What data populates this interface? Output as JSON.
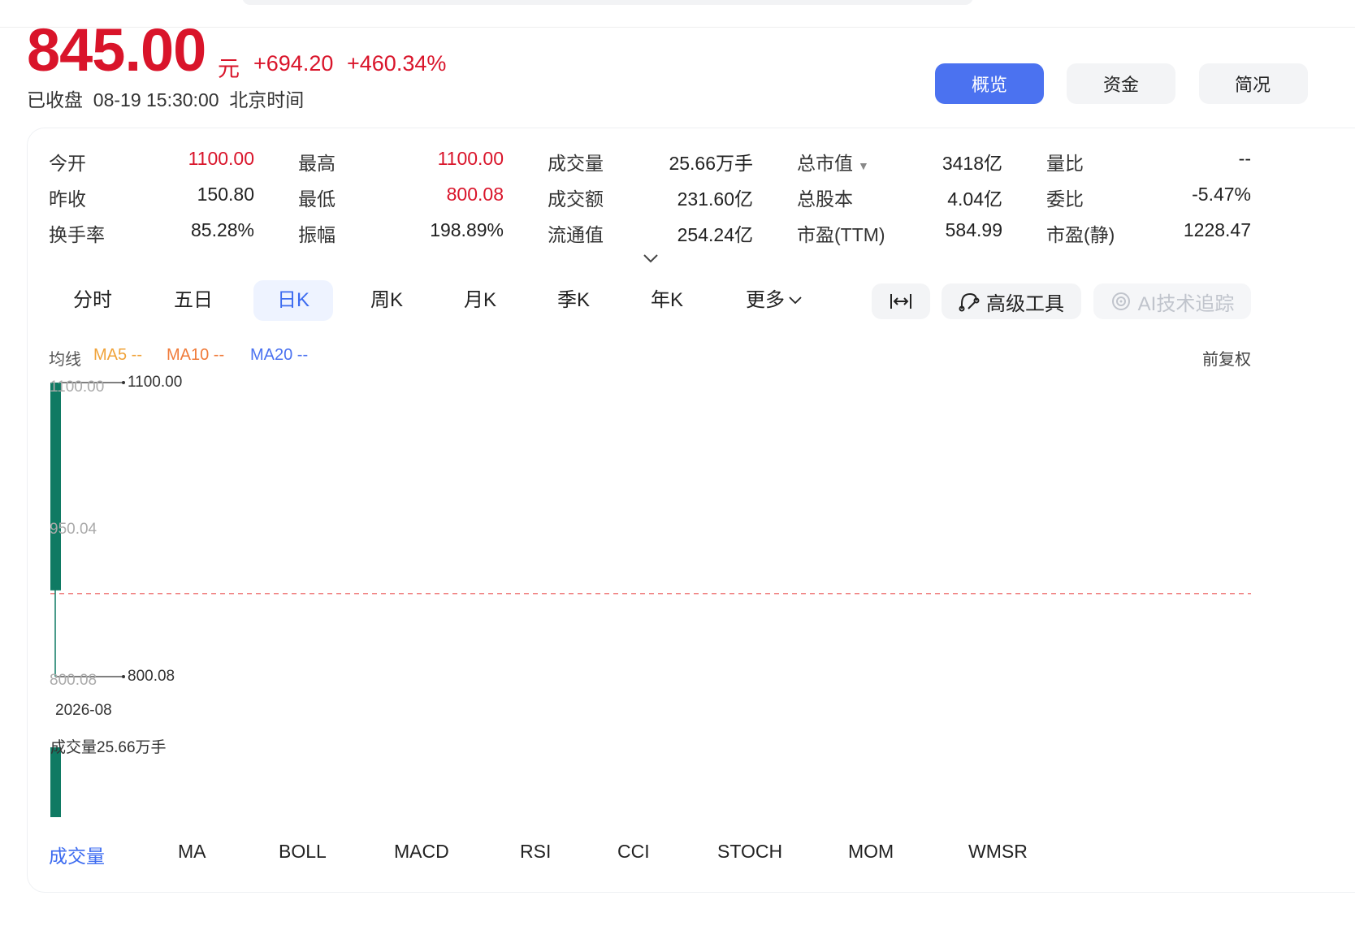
{
  "header": {
    "price": "845.00",
    "unit": "元",
    "change": "+694.20",
    "change_pct": "+460.34%",
    "status": "已收盘  08-19 15:30:00  北京时间"
  },
  "view_tabs": [
    {
      "label": "概览",
      "active": true
    },
    {
      "label": "资金",
      "active": false
    },
    {
      "label": "简况",
      "active": false
    }
  ],
  "quote": {
    "open": {
      "label": "今开",
      "value": "1100.00"
    },
    "high": {
      "label": "最高",
      "value": "1100.00"
    },
    "volume": {
      "label": "成交量",
      "value": "25.66万手"
    },
    "market_cap": {
      "label": "总市值",
      "value": "3418亿"
    },
    "volume_ratio": {
      "label": "量比",
      "value": "--"
    },
    "prev_close": {
      "label": "昨收",
      "value": "150.80"
    },
    "low": {
      "label": "最低",
      "value": "800.08"
    },
    "turnover_amount": {
      "label": "成交额",
      "value": "231.60亿"
    },
    "total_shares": {
      "label": "总股本",
      "value": "4.04亿"
    },
    "order_ratio": {
      "label": "委比",
      "value": "-5.47%"
    },
    "turnover_rate": {
      "label": "换手率",
      "value": "85.28%"
    },
    "amplitude": {
      "label": "振幅",
      "value": "198.89%"
    },
    "float_value": {
      "label": "流通值",
      "value": "254.24亿"
    },
    "pe_ttm": {
      "label": "市盈(TTM)",
      "value": "584.99"
    },
    "pe_static": {
      "label": "市盈(静)",
      "value": "1228.47"
    }
  },
  "periods": [
    {
      "label": "分时",
      "active": false
    },
    {
      "label": "五日",
      "active": false
    },
    {
      "label": "日K",
      "active": true
    },
    {
      "label": "周K",
      "active": false
    },
    {
      "label": "月K",
      "active": false
    },
    {
      "label": "季K",
      "active": false
    },
    {
      "label": "年K",
      "active": false
    },
    {
      "label": "更多",
      "active": false
    }
  ],
  "tools": {
    "advanced": "高级工具",
    "ai": "AI技术追踪"
  },
  "ma_legend": {
    "title": "均线",
    "ma5": "MA5 --",
    "ma10": "MA10 --",
    "ma20": "MA20 --"
  },
  "adjust": "前复权",
  "chart_labels": {
    "y_top": "1100.00",
    "y_mid": "950.04",
    "y_bottom": "800.08",
    "high_marker": "1100.00",
    "low_marker": "800.08",
    "date": "2026-08",
    "volume_label": "成交量25.66万手"
  },
  "indicators": [
    {
      "label": "成交量",
      "active": true
    },
    {
      "label": "MA",
      "active": false
    },
    {
      "label": "BOLL",
      "active": false
    },
    {
      "label": "MACD",
      "active": false
    },
    {
      "label": "RSI",
      "active": false
    },
    {
      "label": "CCI",
      "active": false
    },
    {
      "label": "STOCH",
      "active": false
    },
    {
      "label": "MOM",
      "active": false
    },
    {
      "label": "WMSR",
      "active": false
    }
  ],
  "colors": {
    "up": "#d9142a",
    "down_candle": "#0f7a63",
    "accent": "#4b72f0",
    "ma5": "#f0a33a",
    "ma10": "#f07b3a",
    "ma20": "#4b72f0",
    "prev_close_line": "#f08080"
  },
  "chart_data": {
    "type": "candlestick",
    "date": "2026-08",
    "candles": [
      {
        "open": 1100.0,
        "high": 1100.0,
        "low": 800.08,
        "close": 845.0
      }
    ],
    "prev_close": 150.8,
    "volume": "25.66万手",
    "ylim": [
      800.08,
      1100.0
    ],
    "yticks": [
      1100.0,
      950.04,
      800.08
    ],
    "grid": false
  }
}
